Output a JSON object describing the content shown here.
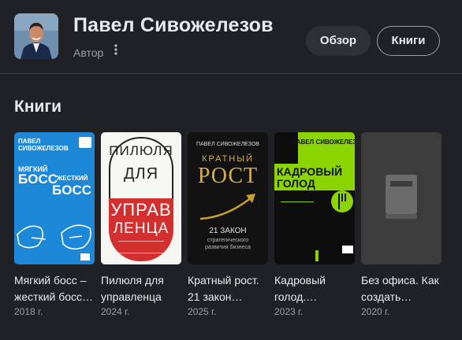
{
  "header": {
    "name": "Павел Сивожелезов",
    "role": "Автор",
    "more_icon": "more-vert-icon",
    "tabs": [
      {
        "label": "Обзор"
      },
      {
        "label": "Книги"
      }
    ]
  },
  "section": {
    "title": "Книги"
  },
  "books": [
    {
      "title_line1": "Мягкий босс –",
      "title_line2": "жесткий босс…",
      "year": "2018 г.",
      "cover": {
        "author": "ПАВЕЛ СИВОЖЕЛЕЗОВ",
        "line1": "МЯГКИЙ",
        "line2": "БОСС",
        "line3": "ЖЕСТКИЙ",
        "line4": "БОСС",
        "color": "#1e88d8"
      }
    },
    {
      "title_line1": "Пилюля для",
      "title_line2": "управленца",
      "year": "2024 г.",
      "cover": {
        "line1": "ПИЛЮЛЯ",
        "line2": "ДЛЯ",
        "line3": "УПРАВ",
        "line4": "ЛЕНЦА",
        "color": "#d32f2f"
      }
    },
    {
      "title_line1": "Кратный рост.",
      "title_line2": "21 закон…",
      "year": "2025 г.",
      "cover": {
        "author": "ПАВЕЛ СИВОЖЕЛЕЗОВ",
        "line1": "КРАТНЫЙ",
        "line2": "РОСТ",
        "line3": "21 ЗАКОН",
        "line4": "стратегического развития бизнеса",
        "color": "#c9a227"
      }
    },
    {
      "title_line1": "Кадровый",
      "title_line2": "голод.…",
      "year": "2023 г.",
      "cover": {
        "author": "ПАВЕЛ СИВОЖЕЛЕЗОВ",
        "line1": "КАДРОВЫЙ",
        "line2": "ГОЛОД",
        "color": "#8bd400"
      }
    },
    {
      "title_line1": "Без офиса. Как",
      "title_line2": "создать…",
      "year": "2020 г.",
      "cover": {
        "icon": "book-placeholder-icon"
      }
    }
  ]
}
